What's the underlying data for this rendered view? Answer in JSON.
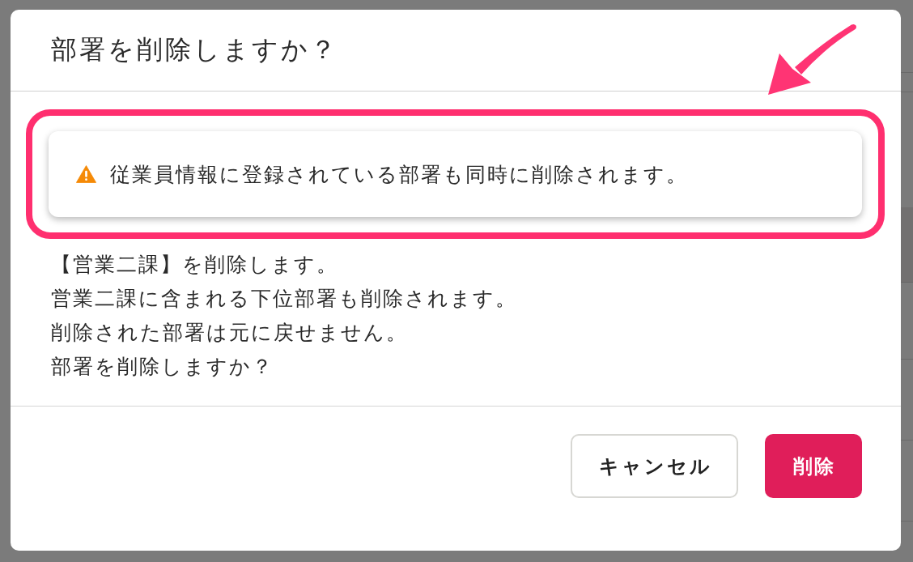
{
  "dialog": {
    "title": "部署を削除しますか？",
    "alert": {
      "kind": "warning",
      "message": "従業員情報に登録されている部署も同時に削除されます。"
    },
    "message_lines": [
      "【営業二課】を削除します。",
      "営業二課に含まれる下位部署も削除されます。",
      "削除された部署は元に戻せません。",
      "部署を削除しますか？"
    ],
    "buttons": [
      {
        "label": "キャンセル",
        "kind": "secondary"
      },
      {
        "label": "削除",
        "kind": "danger"
      }
    ]
  }
}
